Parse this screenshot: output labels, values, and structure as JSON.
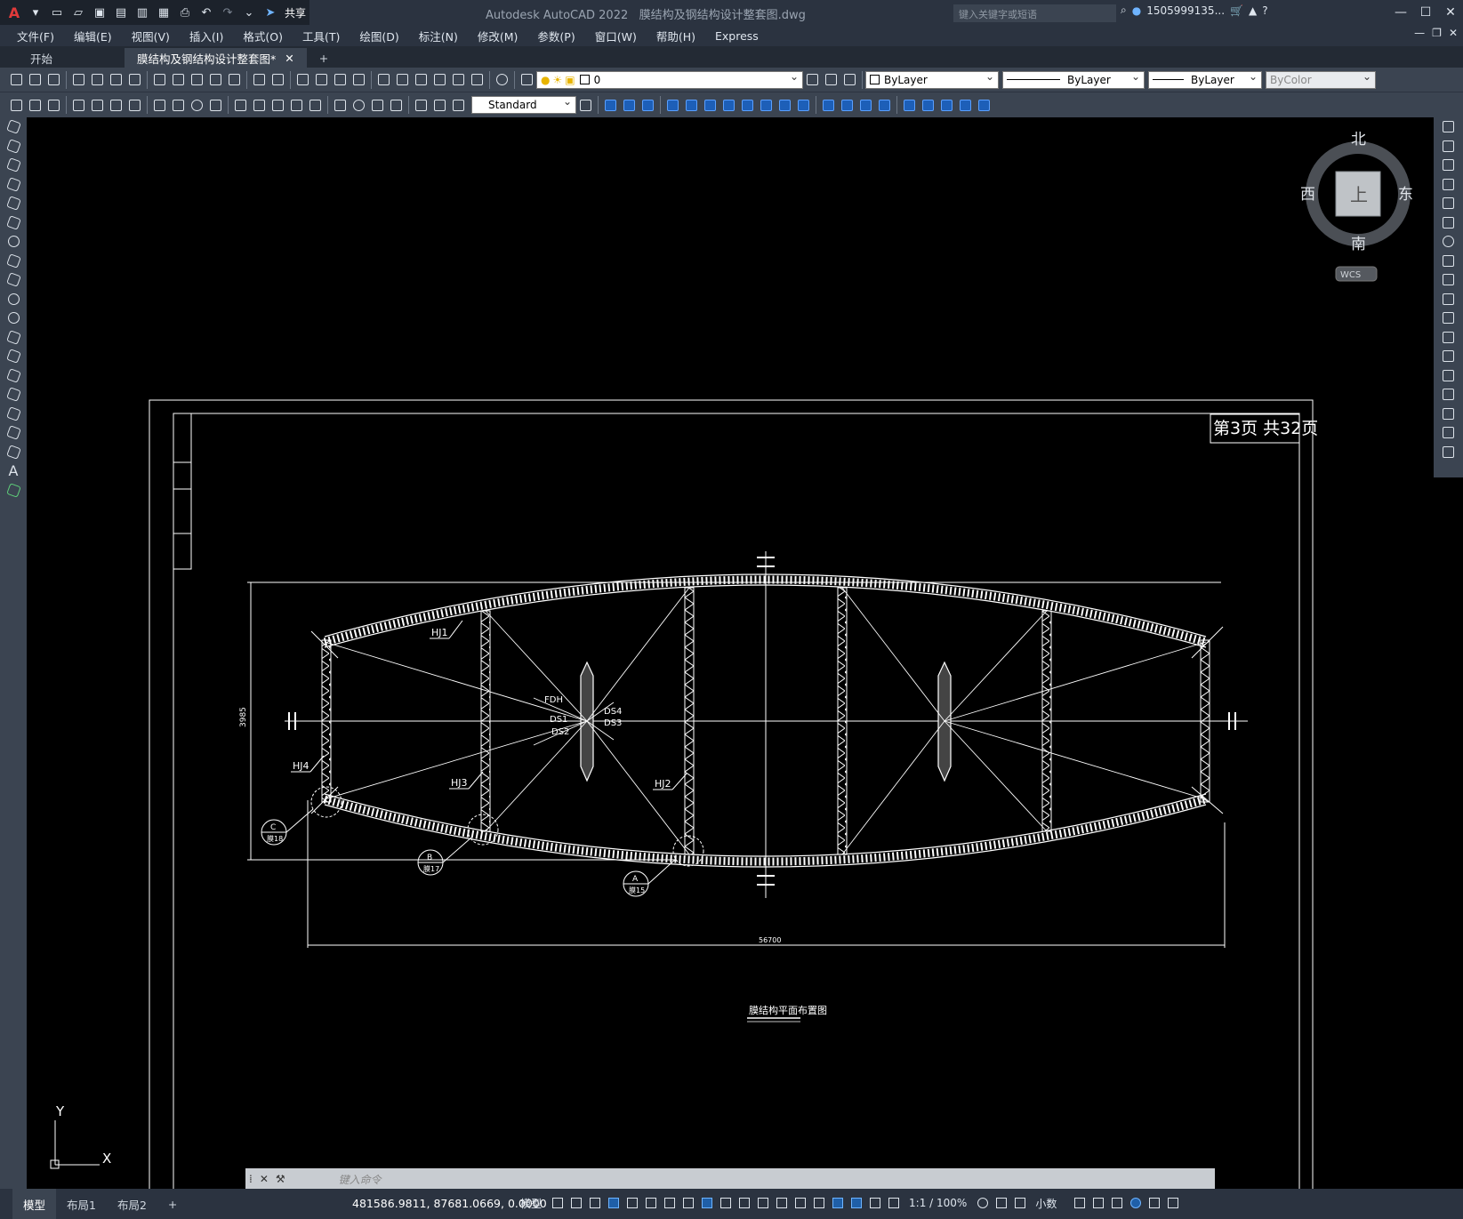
{
  "window": {
    "app_title": "Autodesk AutoCAD 2022",
    "file_name": "膜结构及钢结构设计整套图.dwg",
    "share_label": "共享",
    "search_placeholder": "键入关键字或短语",
    "user": "1505999135...",
    "min": "—",
    "max": "☐",
    "close": "✕"
  },
  "menu": [
    "文件(F)",
    "编辑(E)",
    "视图(V)",
    "插入(I)",
    "格式(O)",
    "工具(T)",
    "绘图(D)",
    "标注(N)",
    "修改(M)",
    "参数(P)",
    "窗口(W)",
    "帮助(H)",
    "Express"
  ],
  "tabs": [
    {
      "label": "开始"
    },
    {
      "label": "膜结构及钢结构设计整套图*"
    }
  ],
  "tab_add": "+",
  "toolbar": {
    "layer": "0",
    "color": "ByLayer",
    "linetype": "ByLayer",
    "lineweight": "ByLayer",
    "plotstyle": "ByColor",
    "textstyle": "Standard"
  },
  "viewcube": {
    "north": "北",
    "south": "南",
    "east": "东",
    "west": "西",
    "top": "上",
    "wcs": "WCS"
  },
  "drawing": {
    "page_no": "第3页 共32页",
    "title": "膜结构平面布置图",
    "dim_width": "56700",
    "dim_height": "3985",
    "labels": {
      "hj1": "HJ1",
      "hj2": "HJ2",
      "hj3": "HJ3",
      "hj4": "HJ4",
      "fdh": "FDH",
      "ds1": "DS1",
      "ds2": "DS2",
      "ds3": "DS3",
      "ds4": "DS4"
    },
    "detail_a": {
      "id": "A",
      "sheet": "膜15"
    },
    "detail_b": {
      "id": "B",
      "sheet": "膜17"
    },
    "detail_c": {
      "id": "C",
      "sheet": "膜18"
    }
  },
  "ucs": {
    "x": "X",
    "y": "Y"
  },
  "cmd": {
    "placeholder": "键入命令"
  },
  "layouts": [
    "模型",
    "布局1",
    "布局2"
  ],
  "layout_add": "+",
  "status": {
    "coords": "481586.9811, 87681.0669, 0.0000",
    "space": "模型",
    "scale": "1:1 / 100%",
    "units": "小数"
  }
}
